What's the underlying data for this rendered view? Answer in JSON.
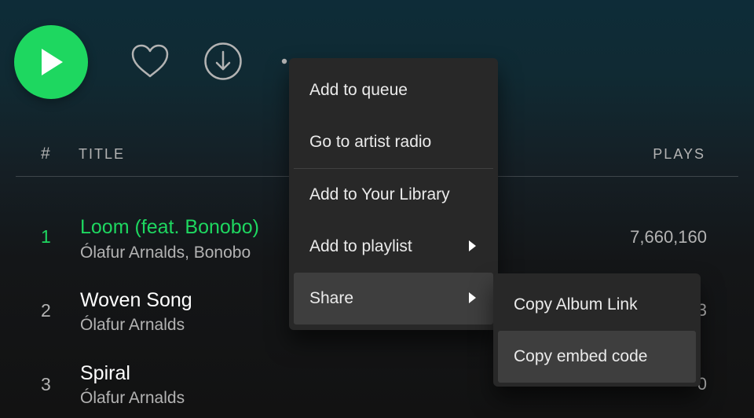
{
  "actions": {
    "play_icon": "play-icon",
    "like_icon": "heart-icon",
    "download_icon": "download-icon",
    "more_icon": "more-icon"
  },
  "table": {
    "header_index": "#",
    "header_title": "TITLE",
    "header_plays": "PLAYS"
  },
  "tracks": [
    {
      "index": "1",
      "title": "Loom (feat. Bonobo)",
      "artist": "Ólafur Arnalds, Bonobo",
      "plays": "7,660,160",
      "active": true
    },
    {
      "index": "2",
      "title": "Woven Song",
      "artist": "Ólafur Arnalds",
      "plays": "3"
    },
    {
      "index": "3",
      "title": "Spiral",
      "artist": "Ólafur Arnalds",
      "plays": "0"
    }
  ],
  "context_menu": {
    "items": [
      {
        "label": "Add to queue"
      },
      {
        "label": "Go to artist radio"
      },
      {
        "label": "Add to Your Library"
      },
      {
        "label": "Add to playlist",
        "submenu": true
      },
      {
        "label": "Share",
        "submenu": true,
        "highlighted": true
      }
    ]
  },
  "share_submenu": {
    "items": [
      {
        "label": "Copy Album Link"
      },
      {
        "label": "Copy embed code",
        "highlighted": true
      }
    ]
  },
  "colors": {
    "accent": "#1ed760",
    "menu_bg": "#282828",
    "menu_highlight": "#3e3e3e",
    "muted_text": "#b3b3b3"
  }
}
